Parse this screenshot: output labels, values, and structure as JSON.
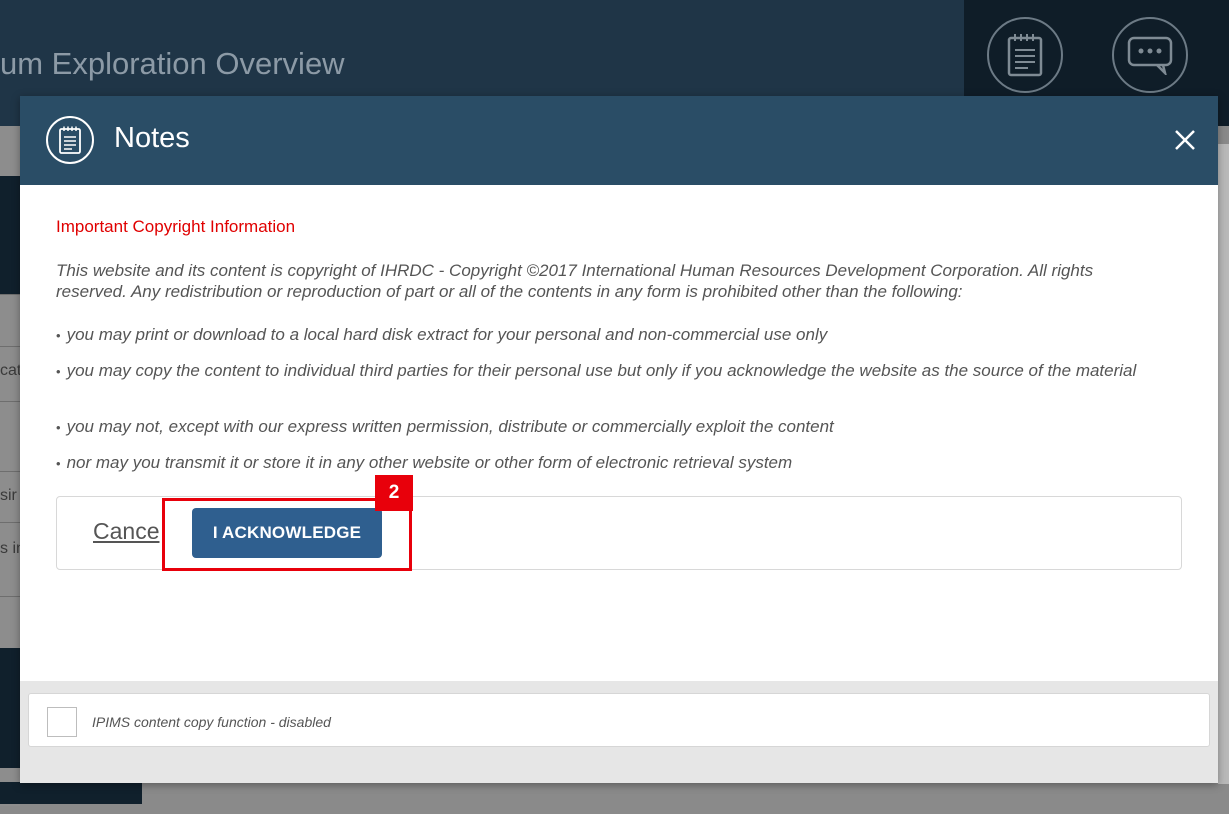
{
  "background": {
    "page_title": "um Exploration Overview",
    "sidebar_fragments": [
      "cat",
      "sir",
      "s in"
    ]
  },
  "header_icons": {
    "notes_icon": "notes-icon",
    "chat_icon": "chat-icon"
  },
  "modal": {
    "title": "Notes",
    "icon": "notes-icon",
    "close_icon": "close-icon",
    "section_heading": "Important Copyright Information",
    "paragraph": "This website and its content is copyright of IHRDC - Copyright ©2017 International Human Resources Development Corporation. All rights reserved. Any redistribution or reproduction of part or all of the contents in any form is prohibited other than the following:",
    "bullets": [
      "you may print or download to a local hard disk extract for your personal and non-commercial use only",
      "you may copy the content to individual third parties for their personal use but only if you acknowledge the website as the source of the material",
      "you may not, except with our express written permission, distribute or commercially exploit the content",
      "nor may you transmit it or store it in any other website or other form of electronic retrieval system"
    ],
    "cancel_label": "Cance",
    "acknowledge_label": "I ACKNOWLEDGE",
    "highlight_badge": "2",
    "checkbox_label": "IPIMS content copy function - disabled"
  },
  "colors": {
    "header_bg": "#2a4d66",
    "heading_red": "#e00000",
    "button_blue": "#2f5f8f",
    "highlight_red": "#e8000b"
  }
}
